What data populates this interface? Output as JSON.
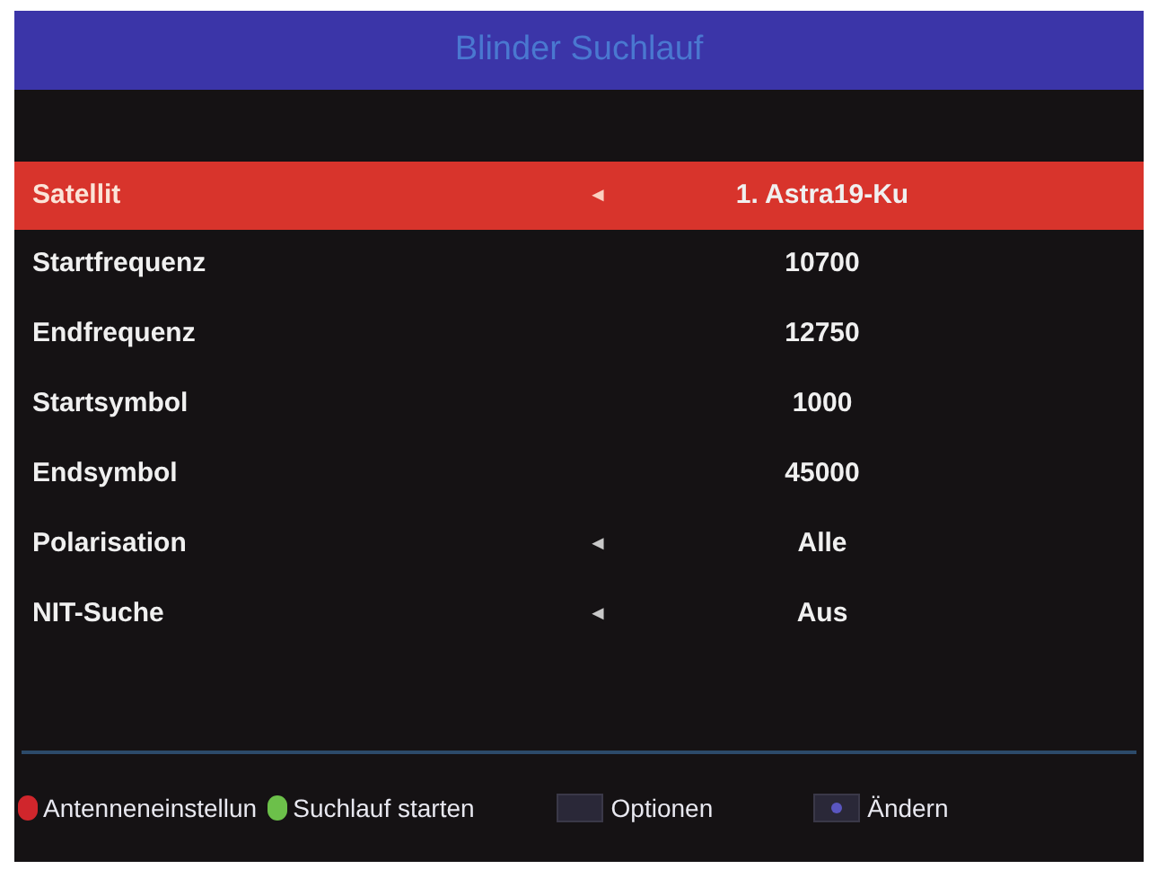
{
  "window": {
    "title": "Blinder Suchlauf"
  },
  "rows": [
    {
      "label": "Satellit",
      "arrow": "◄",
      "value": "1. Astra19-Ku",
      "selected": true
    },
    {
      "label": "Startfrequenz",
      "value": "10700",
      "selected": false
    },
    {
      "label": "Endfrequenz",
      "value": "12750",
      "selected": false
    },
    {
      "label": "Startsymbol",
      "value": "1000",
      "selected": false
    },
    {
      "label": "Endsymbol",
      "value": "45000",
      "selected": false
    },
    {
      "label": "Polarisation",
      "arrow": "◄",
      "value": "Alle",
      "selected": false
    },
    {
      "label": "NIT-Suche",
      "arrow": "◄",
      "value": "Aus",
      "selected": false
    }
  ],
  "footer": [
    {
      "kind": "dot",
      "color": "#d0262c",
      "label": "Antenneneinstellun"
    },
    {
      "kind": "dot",
      "color": "#6cc04a",
      "label": "Suchlauf starten"
    },
    {
      "kind": "key",
      "label": "Optionen"
    },
    {
      "kind": "key",
      "label": "Ändern"
    }
  ]
}
